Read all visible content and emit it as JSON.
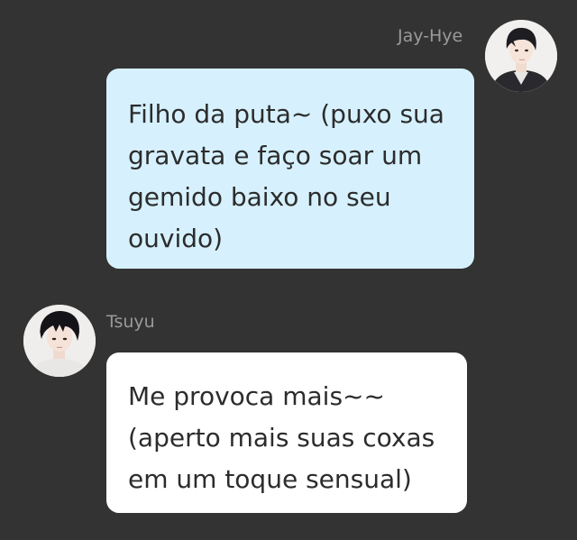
{
  "messages": [
    {
      "author": "Jay-Hye",
      "side": "right",
      "lines": [
        "Filho da puta~ (puxo sua",
        "gravata e faço soar um",
        "gemido baixo no seu",
        "ouvido)"
      ]
    },
    {
      "author": "Tsuyu",
      "side": "left",
      "lines": [
        "Me provoca mais~~",
        "(aperto mais suas coxas",
        "em um toque sensual)"
      ]
    }
  ],
  "colors": {
    "background": "#333333",
    "outgoing_bubble": "#d6f1fd",
    "incoming_bubble": "#ffffff",
    "username": "#9a9a9a",
    "message_text": "#2c2c2c"
  },
  "icons": {
    "jay_hye_avatar": "avatar-icon",
    "tsuyu_avatar": "avatar-icon"
  }
}
